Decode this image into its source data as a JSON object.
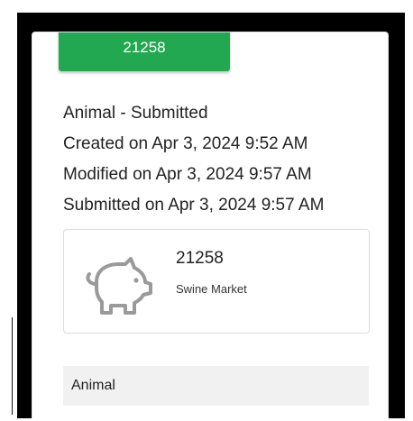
{
  "badge": {
    "id_label": "21258"
  },
  "meta": {
    "title": "Animal - Submitted",
    "created": "Created on Apr 3, 2024 9:52 AM",
    "modified": "Modified on Apr 3, 2024 9:57 AM",
    "submitted": "Submitted on Apr 3, 2024 9:57 AM"
  },
  "animal": {
    "icon": "pig-icon",
    "id": "21258",
    "type": "Swine Market"
  },
  "section": {
    "title": "Animal"
  },
  "colors": {
    "accent": "#21a851",
    "frame": "#000000",
    "section_bg": "#f1f1f1",
    "icon": "#9a9a9a"
  }
}
